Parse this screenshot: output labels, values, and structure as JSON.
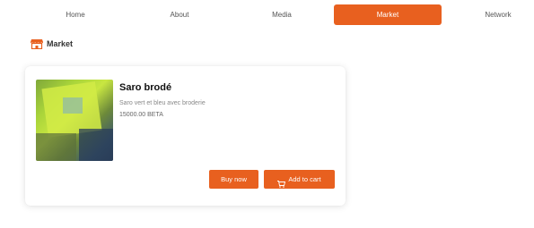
{
  "nav": {
    "items": [
      {
        "label": "Home",
        "active": false
      },
      {
        "label": "About",
        "active": false
      },
      {
        "label": "Media",
        "active": false
      },
      {
        "label": "Market",
        "active": true
      },
      {
        "label": "Network",
        "active": false
      }
    ]
  },
  "section": {
    "title": "Market",
    "icon": "storefront-icon"
  },
  "product": {
    "name": "Saro brodé",
    "description": "Saro vert et bleu avec broderie",
    "price": "15000.00 BETA",
    "image_icon": "product-image"
  },
  "actions": {
    "buy_label": "Buy now",
    "cart_label": "Add to cart",
    "cart_icon": "cart-icon"
  },
  "colors": {
    "accent": "#e8601f",
    "background": "#ffffff"
  }
}
